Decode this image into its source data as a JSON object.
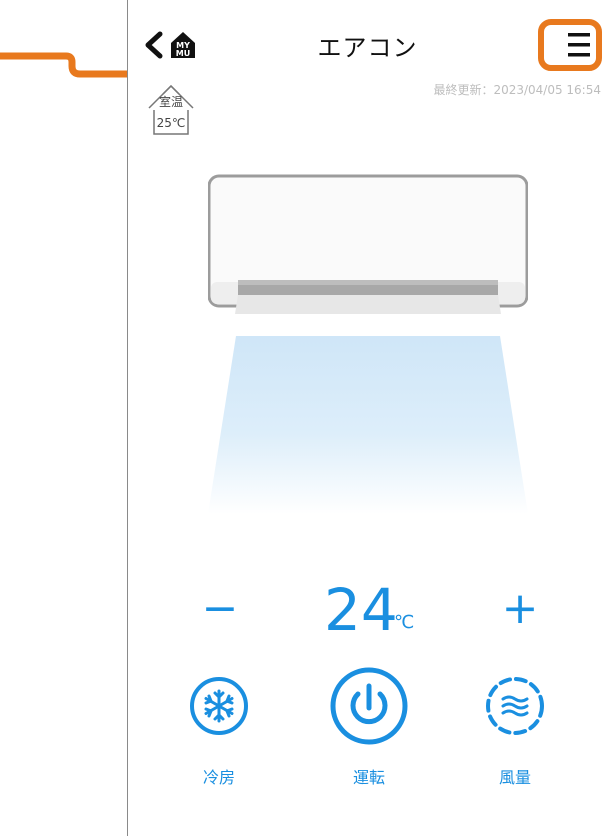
{
  "header": {
    "title": "エアコン",
    "logo_text": "MY MU"
  },
  "last_updated": "最終更新：2023/04/05 16:54",
  "room": {
    "label": "室温",
    "temperature": "25℃"
  },
  "setpoint": {
    "value": "24",
    "unit": "℃",
    "minus_label": "−",
    "plus_label": "+"
  },
  "controls": {
    "mode_label": "冷房",
    "power_label": "運転",
    "fan_label": "風量"
  },
  "colors": {
    "accent": "#1a8fe0",
    "callout": "#e8791e"
  }
}
